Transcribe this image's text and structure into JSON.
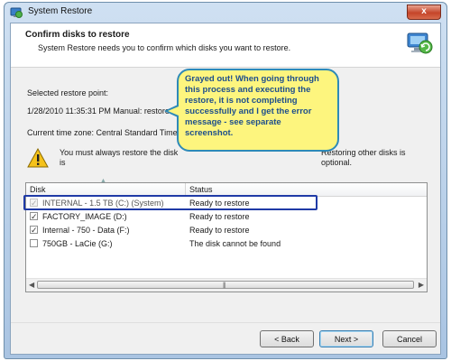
{
  "window": {
    "title": "System Restore",
    "close_label": "x"
  },
  "header": {
    "title": "Confirm disks to restore",
    "subtitle": "System Restore needs you to confirm which disks you want to restore."
  },
  "restore_point": {
    "label": "Selected restore point:",
    "value": "1/28/2010 11:35:31 PM Manual: restore"
  },
  "timezone": {
    "label": "Current time zone: Central Standard Time"
  },
  "warning": {
    "text": "You must always restore the disk",
    "text_right": "Restoring other disks is optional.",
    "text_cont": "is"
  },
  "table": {
    "columns": [
      "Disk",
      "Status"
    ],
    "rows": [
      {
        "disk": "INTERNAL - 1.5 TB  (C:) (System)",
        "status": "Ready to restore",
        "checked": true,
        "disabled": true
      },
      {
        "disk": "FACTORY_IMAGE (D:)",
        "status": "Ready to restore",
        "checked": true,
        "disabled": false
      },
      {
        "disk": "Internal - 750 - Data (F:)",
        "status": "Ready to restore",
        "checked": true,
        "disabled": false
      },
      {
        "disk": "750GB - LaCie (G:)",
        "status": "The disk cannot be found",
        "checked": false,
        "disabled": false
      }
    ]
  },
  "buttons": {
    "back": "< Back",
    "next": "Next >",
    "cancel": "Cancel"
  },
  "annotation": {
    "text": "Grayed out! When going through this process and executing the restore, it is not completing successfully and I get the error message - see separate screenshot.",
    "color": "#fdf57e",
    "highlight_color": "#1f3aa6"
  }
}
